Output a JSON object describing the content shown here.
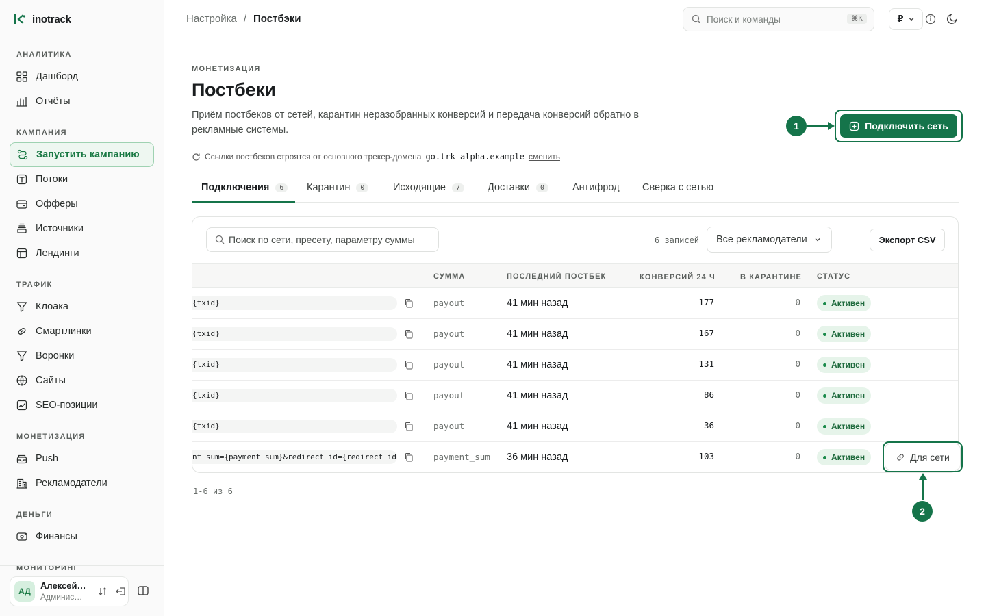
{
  "app": {
    "name": "inotrack"
  },
  "sidebar": {
    "sections": [
      {
        "title": "АНАЛИТИКА",
        "items": [
          {
            "label": "Дашборд",
            "icon": "grid-icon"
          },
          {
            "label": "Отчёты",
            "icon": "bar-chart-icon"
          }
        ]
      },
      {
        "title": "КАМПАНИЯ",
        "items": [
          {
            "label": "Запустить кампанию",
            "icon": "route-icon",
            "active": true
          },
          {
            "label": "Потоки",
            "icon": "flow-icon"
          },
          {
            "label": "Офферы",
            "icon": "wallet-icon"
          },
          {
            "label": "Источники",
            "icon": "layers-icon"
          },
          {
            "label": "Лендинги",
            "icon": "page-icon"
          }
        ]
      },
      {
        "title": "ТРАФИК",
        "items": [
          {
            "label": "Клоака",
            "icon": "filter-icon"
          },
          {
            "label": "Смартлинки",
            "icon": "link-icon"
          },
          {
            "label": "Воронки",
            "icon": "funnel-icon"
          },
          {
            "label": "Сайты",
            "icon": "globe-icon"
          },
          {
            "label": "SEO-позиции",
            "icon": "trend-icon"
          }
        ]
      },
      {
        "title": "МОНЕТИЗАЦИЯ",
        "items": [
          {
            "label": "Push",
            "icon": "inbox-icon"
          },
          {
            "label": "Рекламодатели",
            "icon": "building-icon"
          }
        ]
      },
      {
        "title": "ДЕНЬГИ",
        "items": [
          {
            "label": "Финансы",
            "icon": "finance-icon"
          }
        ]
      },
      {
        "title": "МОНИТОРИНГ",
        "items": []
      }
    ],
    "user": {
      "initials": "АД",
      "name": "Алексей…",
      "role": "Админис…"
    }
  },
  "topbar": {
    "breadcrumb": [
      "Настройка",
      "Постбэки"
    ],
    "search_placeholder": "Поиск и команды",
    "search_shortcut": "⌘K",
    "currency": "₽"
  },
  "page": {
    "kicker": "МОНЕТИЗАЦИЯ",
    "title": "Постбеки",
    "description": "Приём постбеков от сетей, карантин неразобранных конверсий и передача конверсий обратно в рекламные системы.",
    "domain_note": "Ссылки постбеков строятся от основного трекер-домена",
    "domain": "go.trk-alpha.example",
    "domain_change": "сменить",
    "primary_button": "Подключить сеть",
    "callouts": [
      "1",
      "2"
    ]
  },
  "tabs": [
    {
      "label": "Подключения",
      "count": "6",
      "active": true
    },
    {
      "label": "Карантин",
      "count": "0"
    },
    {
      "label": "Исходящие",
      "count": "7"
    },
    {
      "label": "Доставки",
      "count": "0"
    },
    {
      "label": "Антифрод",
      "count": ""
    },
    {
      "label": "Сверка с сетью",
      "count": ""
    }
  ],
  "table": {
    "search_placeholder": "Поиск по сети, пресету, параметру суммы",
    "records": "6 записей",
    "advertiser_filter": "Все рекламодатели",
    "export_button": "Экспорт CSV",
    "columns": [
      "СУММА",
      "ПОСЛЕДНИЙ ПОСТБЕК",
      "КОНВЕРСИЙ 24 Ч",
      "В КАРАНТИНЕ",
      "СТАТУС"
    ],
    "rows": [
      {
        "url": "{txid}",
        "amount": "payout",
        "last": "41 мин назад",
        "conversions": "177",
        "quarantine": "0",
        "status": "Активен"
      },
      {
        "url": "{txid}",
        "amount": "payout",
        "last": "41 мин назад",
        "conversions": "167",
        "quarantine": "0",
        "status": "Активен"
      },
      {
        "url": "{txid}",
        "amount": "payout",
        "last": "41 мин назад",
        "conversions": "131",
        "quarantine": "0",
        "status": "Активен"
      },
      {
        "url": "{txid}",
        "amount": "payout",
        "last": "41 мин назад",
        "conversions": "86",
        "quarantine": "0",
        "status": "Активен"
      },
      {
        "url": "{txid}",
        "amount": "payout",
        "last": "41 мин назад",
        "conversions": "36",
        "quarantine": "0",
        "status": "Активен"
      },
      {
        "url": "nt_sum={payment_sum}&redirect_id={redirect_id}",
        "amount": "payment_sum",
        "last": "36 мин назад",
        "conversions": "103",
        "quarantine": "0",
        "status": "Активен",
        "action": "Для сети"
      }
    ],
    "pager": "1-6 из 6"
  },
  "colors": {
    "accent": "#15744a",
    "status_bg": "#e6f4ea",
    "status_text": "#1f6b3e"
  }
}
